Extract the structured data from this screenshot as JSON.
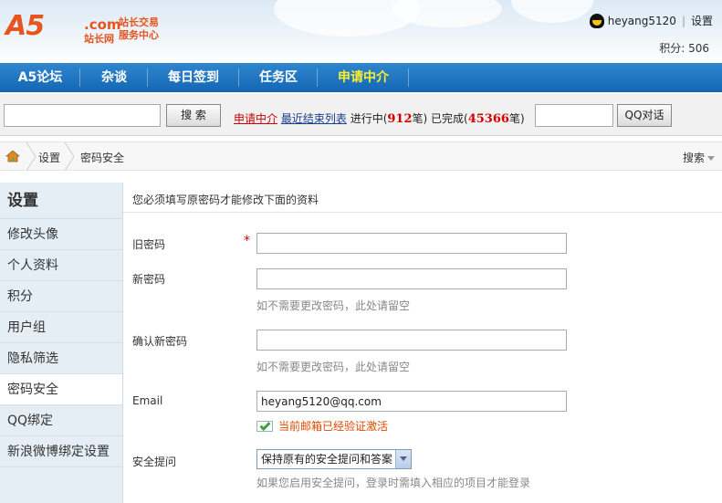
{
  "header": {
    "logo_brand": "A5",
    "logo_com": ".com",
    "logo_site": "站长网",
    "logo_slogan_1": "站长交易",
    "logo_slogan_2": "服务中心",
    "username": "heyang5120",
    "settings_link": "设置",
    "points": "积分: 506",
    "qq_icon": "qq-penguin-icon"
  },
  "nav": {
    "items": [
      {
        "label": "A5论坛"
      },
      {
        "label": "杂谈"
      },
      {
        "label": "每日签到"
      },
      {
        "label": "任务区"
      },
      {
        "label": "申请中介"
      }
    ],
    "active_color": "#ffef2a",
    "bar_color": "#1f76c2"
  },
  "searchbar": {
    "search_value": "",
    "search_button": "搜 索",
    "apply_link": "申请中介",
    "recent_link": "最近结束列表",
    "in_progress_prefix": "进行中(",
    "in_progress_count": "912",
    "in_progress_suffix": "笔)",
    "done_prefix": "已完成(",
    "done_count": "45366",
    "done_suffix": "笔)",
    "qq_value": "",
    "qq_button": "QQ对话"
  },
  "breadcrumb": {
    "home_icon": "home-icon",
    "items": [
      "设置",
      "密码安全"
    ],
    "search_label": "搜索"
  },
  "sidebar": {
    "title": "设置",
    "items": [
      {
        "label": "修改头像"
      },
      {
        "label": "个人资料"
      },
      {
        "label": "积分"
      },
      {
        "label": "用户组"
      },
      {
        "label": "隐私筛选"
      },
      {
        "label": "密码安全"
      },
      {
        "label": "QQ绑定"
      },
      {
        "label": "新浪微博绑定设置"
      }
    ],
    "active_index": 5
  },
  "form": {
    "notice": "您必须填写原密码才能修改下面的资料",
    "old_password_label": "旧密码",
    "required_mark": "*",
    "old_password_value": "",
    "new_password_label": "新密码",
    "new_password_value": "",
    "new_password_hint": "如不需要更改密码，此处请留空",
    "confirm_password_label": "确认新密码",
    "confirm_password_value": "",
    "confirm_password_hint": "如不需要更改密码，此处请留空",
    "email_label": "Email",
    "email_value": "heyang5120@qq.com",
    "email_verified": "当前邮箱已经验证激活",
    "security_label": "安全提问",
    "security_selected": "保持原有的安全提问和答案",
    "security_hint": "如果您启用安全提问，登录时需填入相应的项目才能登录"
  }
}
